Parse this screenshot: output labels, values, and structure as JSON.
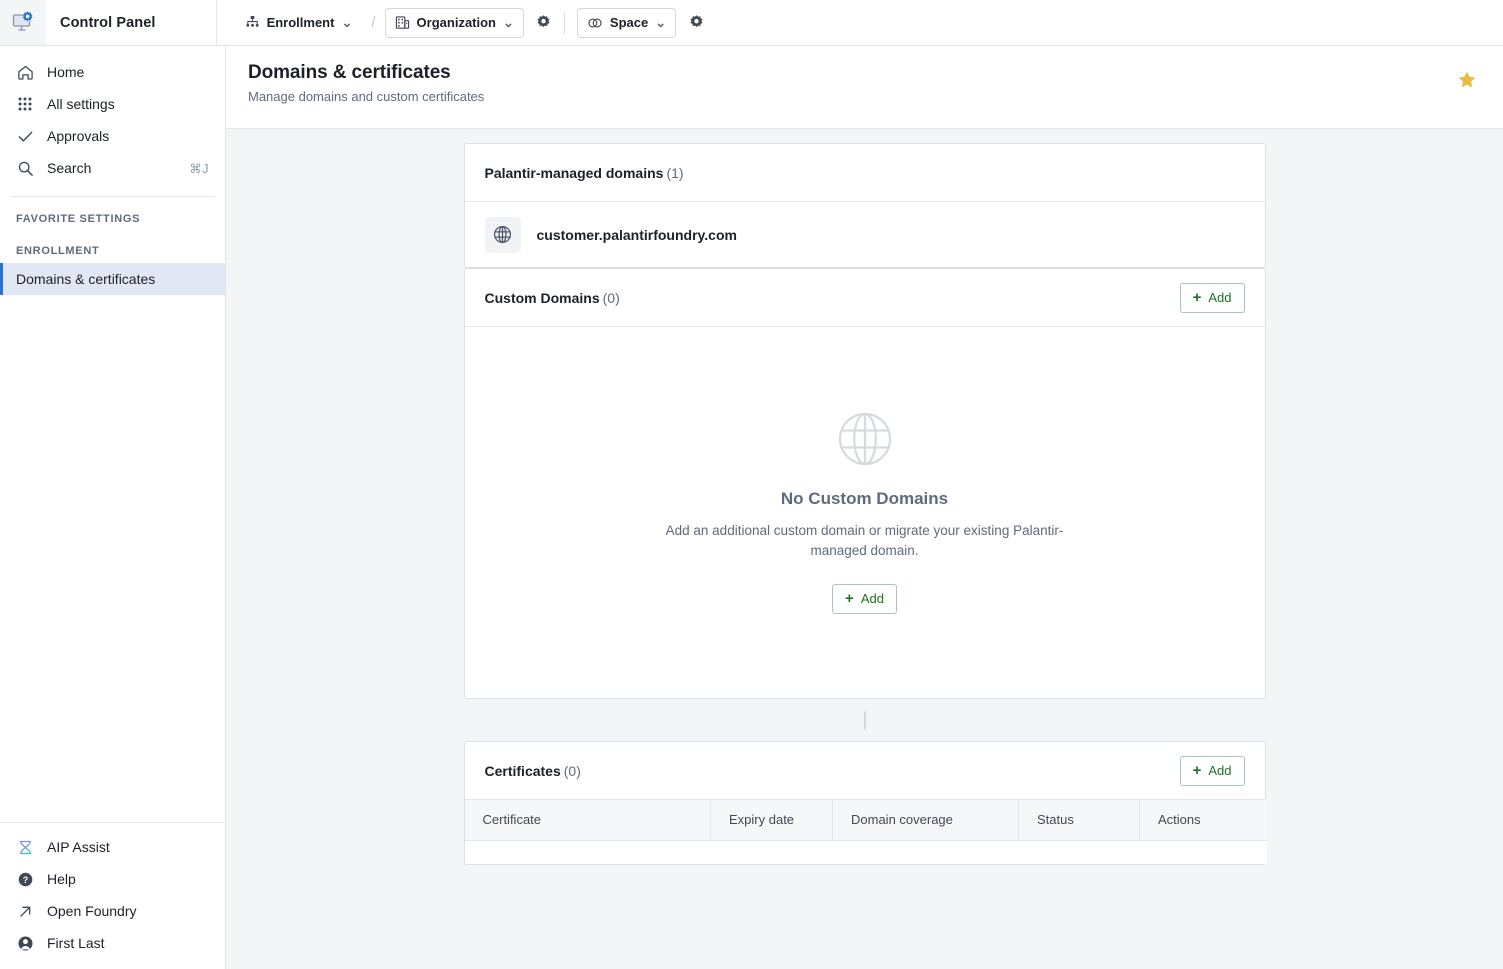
{
  "topbar": {
    "logo_icon": "monitor-gear-icon",
    "product_name": "Control Panel",
    "enrollment_label": "Enrollment",
    "enrollment_icon": "hierarchy-icon",
    "breadcrumb_separator": "/",
    "organization_label": "Organization",
    "organization_icon": "office-building-icon",
    "organization_settings_icon": "gear-icon",
    "space_label": "Space",
    "space_icon": "overlapping-circles-icon",
    "space_settings_icon": "gear-icon",
    "caret": "⌄"
  },
  "sidebar": {
    "primary_items": [
      {
        "label": "Home",
        "icon": "home-icon",
        "shortcut": ""
      },
      {
        "label": "All settings",
        "icon": "grid-dots-icon",
        "shortcut": ""
      },
      {
        "label": "Approvals",
        "icon": "check-icon",
        "shortcut": ""
      },
      {
        "label": "Search",
        "icon": "search-icon",
        "shortcut": "⌘J"
      }
    ],
    "favorite_settings_heading": "FAVORITE SETTINGS",
    "enrollment_heading": "ENROLLMENT",
    "nav_items": [
      {
        "label": "Domains & certificates",
        "selected": true
      }
    ],
    "bottom_items": [
      {
        "label": "AIP Assist",
        "icon": "aip-assist-icon"
      },
      {
        "label": "Help",
        "icon": "help-circle-icon"
      },
      {
        "label": "Open Foundry",
        "icon": "arrow-up-right-icon"
      },
      {
        "label": "First Last",
        "icon": "user-avatar-icon"
      }
    ],
    "selected_bg": "#e2e8f3",
    "selected_accent": "#2d72d2"
  },
  "header": {
    "title": "Domains & certificates",
    "subtitle": "Manage domains and custom certificates",
    "favorite_icon": "star-filled-icon",
    "favorite_color": "#e8bb43"
  },
  "managed_domains": {
    "title": "Palantir-managed domains",
    "count": "(1)",
    "rows": [
      {
        "name": "customer.palantirfoundry.com",
        "icon": "globe-icon"
      }
    ]
  },
  "custom_domains": {
    "title": "Custom Domains",
    "count": "(0)",
    "add_label": "Add",
    "add_icon": "plus-icon",
    "empty_icon": "globe-large-icon",
    "empty_title": "No Custom Domains",
    "empty_description": "Add an additional custom domain or migrate your existing Palantir-managed domain.",
    "empty_add_label": "Add",
    "accent_color": "#1d7324"
  },
  "certificates": {
    "title": "Certificates",
    "count": "(0)",
    "add_label": "Add",
    "add_icon": "plus-icon",
    "columns": [
      "Certificate",
      "Expiry date",
      "Domain coverage",
      "Status",
      "Actions"
    ],
    "rows": []
  }
}
